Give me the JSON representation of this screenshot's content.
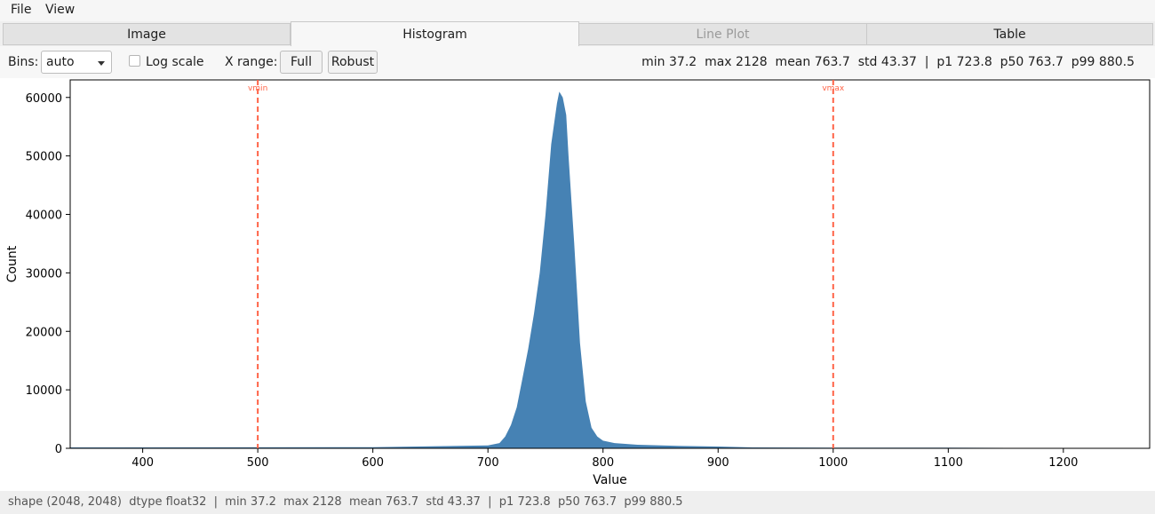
{
  "menu": {
    "file": "File",
    "view": "View"
  },
  "tabs": [
    {
      "label": "Image",
      "state": "normal"
    },
    {
      "label": "Histogram",
      "state": "active"
    },
    {
      "label": "Line Plot",
      "state": "disabled"
    },
    {
      "label": "Table",
      "state": "normal"
    }
  ],
  "toolbar": {
    "bins_label": "Bins:",
    "bins_value": "auto",
    "log_scale_label": "Log scale",
    "log_scale_checked": false,
    "xrange_label": "X range:",
    "full_button": "Full",
    "robust_button": "Robust",
    "stats": "min 37.2  max 2128  mean 763.7  std 43.37  |  p1 723.8  p50 763.7  p99 880.5"
  },
  "status": "shape (2048, 2048)  dtype float32  |  min 37.2  max 2128  mean 763.7  std 43.37  |  p1 723.8  p50 763.7  p99 880.5",
  "chart_data": {
    "type": "bar",
    "title": "",
    "xlabel": "Value",
    "ylabel": "Count",
    "xlim": [
      337,
      1275
    ],
    "ylim": [
      0,
      63000
    ],
    "xticks": [
      400,
      500,
      600,
      700,
      800,
      900,
      1000,
      1100,
      1200
    ],
    "yticks": [
      0,
      10000,
      20000,
      30000,
      40000,
      50000,
      60000
    ],
    "grid": false,
    "bar_color": "#4682b4",
    "markers": [
      {
        "label": "vmin",
        "x": 500,
        "color": "#ff6347",
        "style": "dashed"
      },
      {
        "label": "vmax",
        "x": 1000,
        "color": "#ff6347",
        "style": "dashed"
      }
    ],
    "shape_points": {
      "x": [
        337,
        600,
        700,
        710,
        715,
        720,
        725,
        730,
        735,
        740,
        745,
        750,
        755,
        760,
        762,
        765,
        768,
        770,
        775,
        780,
        785,
        790,
        795,
        800,
        810,
        830,
        870,
        900,
        930,
        1000,
        1100,
        1150,
        1160,
        1275
      ],
      "y": [
        150,
        200,
        500,
        900,
        2000,
        4000,
        7000,
        12000,
        17000,
        23000,
        30000,
        40000,
        52000,
        59000,
        61000,
        60000,
        57000,
        50000,
        35000,
        18000,
        8000,
        3500,
        2000,
        1300,
        900,
        600,
        400,
        300,
        150,
        120,
        100,
        80,
        0,
        0
      ]
    }
  }
}
